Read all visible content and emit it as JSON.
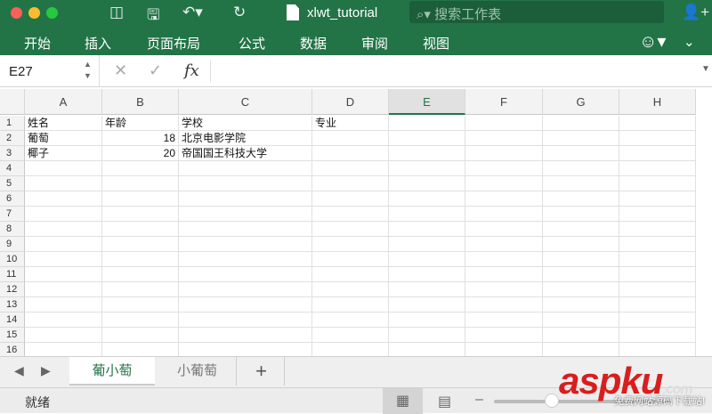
{
  "title": {
    "filename": "xlwt_tutorial",
    "search_placeholder": "搜索工作表"
  },
  "ribbon": {
    "tabs": [
      "开始",
      "插入",
      "页面布局",
      "公式",
      "数据",
      "审阅",
      "视图"
    ]
  },
  "formula_bar": {
    "name_box": "E27",
    "fx": "fx",
    "formula": ""
  },
  "columns": [
    "A",
    "B",
    "C",
    "D",
    "E",
    "F",
    "G",
    "H"
  ],
  "active_column": "E",
  "rows": [
    "1",
    "2",
    "3",
    "4",
    "5",
    "6",
    "7",
    "8",
    "9",
    "10",
    "11",
    "12",
    "13",
    "14",
    "15",
    "16"
  ],
  "cells": [
    [
      "姓名",
      "年龄",
      "学校",
      "专业"
    ],
    [
      "葡萄",
      "18",
      "北京电影学院",
      ""
    ],
    [
      "椰子",
      "20",
      "帝国国王科技大学",
      ""
    ]
  ],
  "sheets": [
    "葡小萄",
    "小葡萄"
  ],
  "active_sheet": "葡小萄",
  "status": {
    "text": "就绪"
  },
  "watermark": {
    "brand": "aspku",
    "domain": ".com",
    "slogan": "免费网站源码下载站!"
  },
  "colors": {
    "accent": "#227447"
  }
}
